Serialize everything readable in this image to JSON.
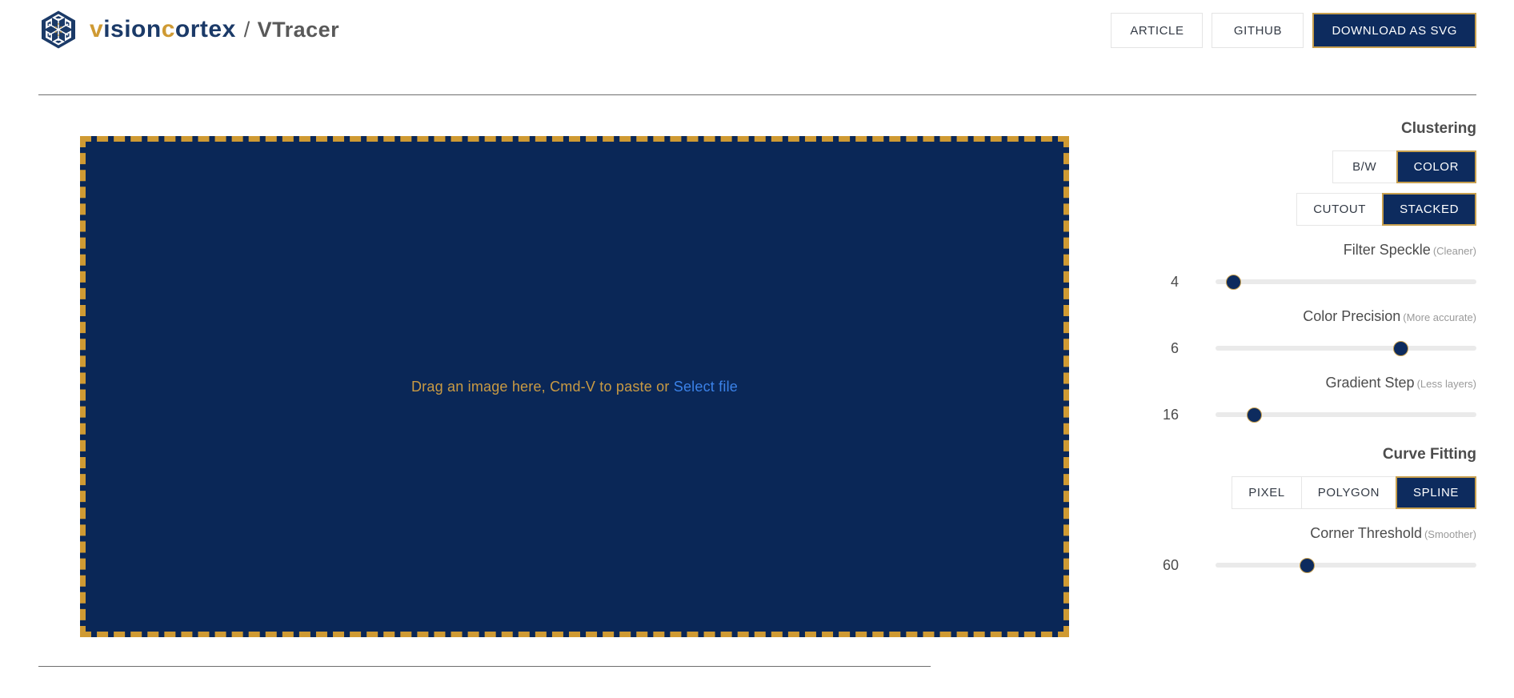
{
  "header": {
    "brand": {
      "logo_icon": "visioncortex-snowflake-logo",
      "part1": "v",
      "part2": "ision",
      "part3": "c",
      "part4": "ortex",
      "separator": "/",
      "app_name": "VTracer"
    },
    "actions": [
      {
        "label": "ARTICLE",
        "primary": false
      },
      {
        "label": "GITHUB",
        "primary": false
      },
      {
        "label": "DOWNLOAD AS SVG",
        "primary": true
      }
    ]
  },
  "dropzone": {
    "text_before": "Drag an image here, Cmd-V to paste or ",
    "link_label": "Select file",
    "background_color": "#0a2757",
    "border_color": "#cf9a33"
  },
  "sidebar": {
    "clustering": {
      "title": "Clustering",
      "mode_group": [
        {
          "label": "B/W",
          "active": false
        },
        {
          "label": "COLOR",
          "active": true
        }
      ],
      "layer_group": [
        {
          "label": "CUTOUT",
          "active": false
        },
        {
          "label": "STACKED",
          "active": true
        }
      ],
      "sliders": [
        {
          "label": "Filter Speckle",
          "hint": "(Cleaner)",
          "value": "4",
          "percent": 7
        },
        {
          "label": "Color Precision",
          "hint": "(More accurate)",
          "value": "6",
          "percent": 71
        },
        {
          "label": "Gradient Step",
          "hint": "(Less layers)",
          "value": "16",
          "percent": 15
        }
      ]
    },
    "curve_fitting": {
      "title": "Curve Fitting",
      "mode_group": [
        {
          "label": "PIXEL",
          "active": false
        },
        {
          "label": "POLYGON",
          "active": false
        },
        {
          "label": "SPLINE",
          "active": true
        }
      ],
      "sliders": [
        {
          "label": "Corner Threshold",
          "hint": "(Smoother)",
          "value": "60",
          "percent": 35
        }
      ]
    }
  },
  "theme": {
    "navy": "#0d2b5e",
    "gold": "#c79f4e",
    "link_blue": "#3b82e8",
    "text_gray": "#4c4c4c"
  }
}
